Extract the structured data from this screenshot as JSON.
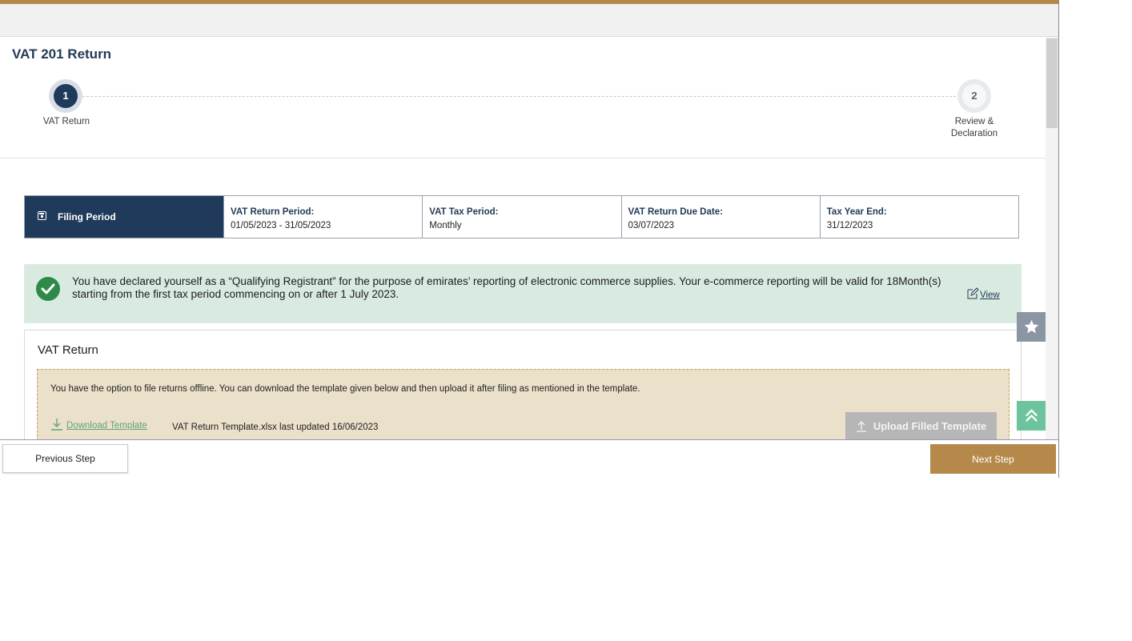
{
  "page": {
    "title": "VAT 201 Return"
  },
  "stepper": {
    "steps": [
      {
        "number": "1",
        "label": "VAT Return"
      },
      {
        "number": "2",
        "label": "Review & Declaration"
      }
    ]
  },
  "filing_period": {
    "title": "Filing Period",
    "cells": [
      {
        "label": "VAT Return Period:",
        "value": "01/05/2023 - 31/05/2023"
      },
      {
        "label": "VAT Tax Period:",
        "value": "Monthly"
      },
      {
        "label": "VAT Return Due Date:",
        "value": "03/07/2023"
      },
      {
        "label": "Tax Year End:",
        "value": "31/12/2023"
      }
    ]
  },
  "notice": {
    "message": "You have declared yourself as a “Qualifying Registrant” for the purpose of emirates’ reporting of electronic commerce supplies. Your e-commerce reporting will be valid for 18Month(s) starting from the first tax period commencing on or after 1 July 2023.",
    "view_label": "View"
  },
  "vat_return": {
    "title": "VAT Return",
    "offline_info": "You have the option to file returns offline. You can download the template given below and then upload it after filing as mentioned in the template.",
    "download_label": "Download Template",
    "template_meta": "VAT Return Template.xlsx last updated 16/06/2023",
    "upload_label": "Upload Filled Template"
  },
  "footer": {
    "previous_label": "Previous Step",
    "next_label": "Next Step"
  },
  "icons": {
    "calendar": "calendar-icon",
    "check": "check-circle-icon",
    "edit": "edit-icon",
    "star": "star-icon",
    "scroll_top": "double-chevron-up-icon",
    "download": "download-icon",
    "upload": "upload-icon"
  },
  "colors": {
    "accent_gold": "#b5894a",
    "navy": "#1f3a5a",
    "success_green": "#2f8a4a",
    "notice_bg": "#d9ebe0",
    "offline_bg": "#ebe0ca"
  }
}
